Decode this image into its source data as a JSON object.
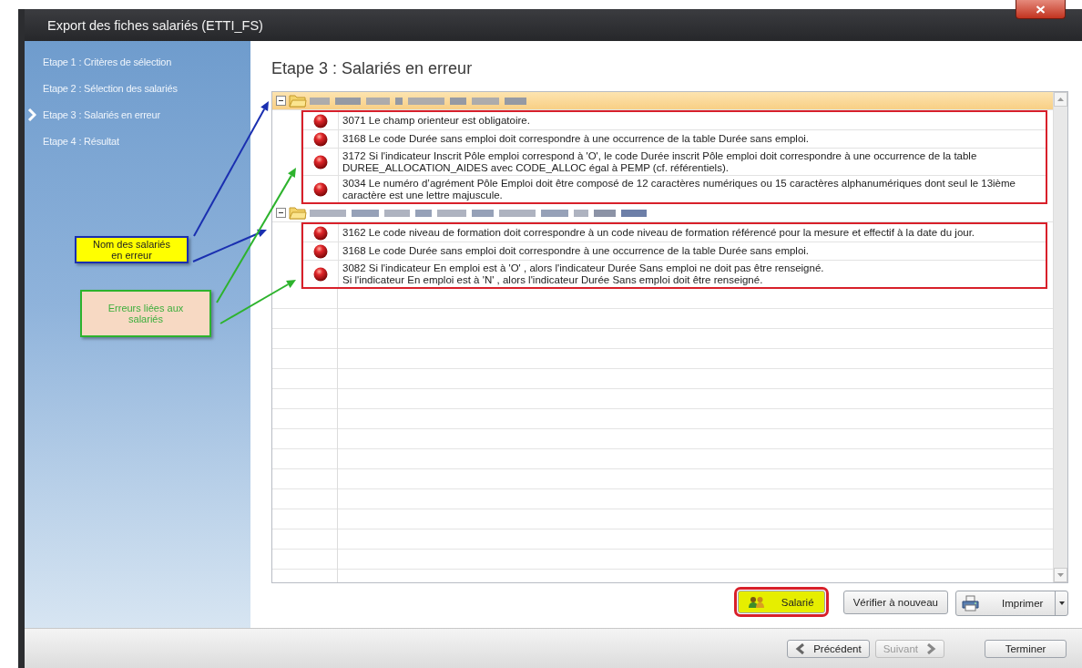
{
  "window": {
    "title": "Export des fiches salariés (ETTI_FS)"
  },
  "steps": [
    {
      "label": "Etape 1 : Critères de sélection",
      "selected": false
    },
    {
      "label": "Etape 2 : Sélection des salariés",
      "selected": false
    },
    {
      "label": "Etape 3 : Salariés en erreur",
      "selected": true
    },
    {
      "label": "Etape 4 : Résultat",
      "selected": false
    }
  ],
  "heading": "Etape 3 : Salariés en erreur",
  "groups": [
    {
      "selected": true,
      "expanded": true,
      "highlighted": true,
      "errors": [
        "3071 Le champ orienteur est obligatoire.",
        "3168 Le code Durée sans emploi doit correspondre à une occurrence de la table Durée sans emploi.",
        "3172 Si l'indicateur Inscrit Pôle emploi correspond à 'O', le code Durée inscrit Pôle emploi doit correspondre à une occurrence de la table DUREE_ALLOCATION_AIDES avec CODE_ALLOC égal à PEMP (cf. référentiels).",
        "3034 Le numéro d’agrément Pôle Emploi doit être composé de 12 caractères numériques ou 15 caractères alphanumériques dont seul le 13ième caractère est une lettre majuscule."
      ]
    },
    {
      "selected": false,
      "expanded": true,
      "highlighted": true,
      "errors": [
        "3162 Le code niveau de formation doit correspondre à un code niveau de formation référencé pour la mesure et effectif à la date du jour.",
        "3168 Le code Durée sans emploi doit correspondre à une occurrence de la table Durée sans emploi.",
        "3082 Si l'indicateur En emploi est à 'O' , alors l'indicateur Durée Sans emploi ne doit pas être renseigné.\nSi l'indicateur En emploi est à 'N' , alors l'indicateur Durée Sans emploi doit être renseigné."
      ]
    }
  ],
  "actions": [
    {
      "label": "Salarié",
      "kind": "people",
      "highlighted": true
    },
    {
      "label": "Vérifier à nouveau",
      "kind": "plain",
      "highlighted": false
    },
    {
      "label": "Imprimer",
      "kind": "printer",
      "highlighted": false
    }
  ],
  "navigation": [
    {
      "label": "Précédent",
      "kind": "back",
      "disabled": false
    },
    {
      "label": "Suivant",
      "kind": "next",
      "disabled": true
    },
    {
      "label": "Terminer",
      "kind": "plain",
      "disabled": false
    }
  ],
  "callouts": [
    {
      "text": "Nom des salariés en erreur",
      "kind": "names",
      "color": "#1a2fb0"
    },
    {
      "text": "Erreurs liées aux salariés",
      "kind": "errors",
      "color": "#2db32d"
    }
  ]
}
